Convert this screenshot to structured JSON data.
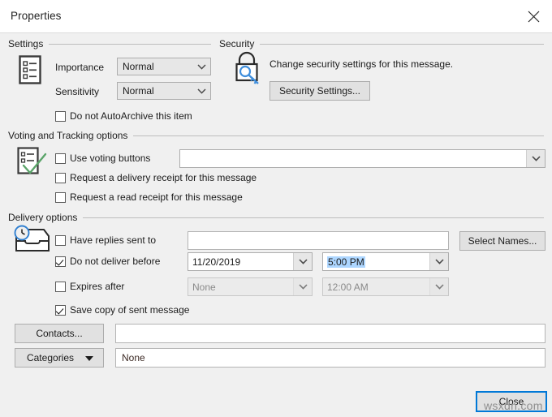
{
  "window": {
    "title": "Properties",
    "close_icon": "close-x-icon"
  },
  "groups": {
    "settings": "Settings",
    "security": "Security",
    "voting": "Voting and Tracking options",
    "delivery": "Delivery options"
  },
  "settings": {
    "icon": "settings-list-icon",
    "importance_label": "Importance",
    "importance_value": "Normal",
    "sensitivity_label": "Sensitivity",
    "sensitivity_value": "Normal",
    "autoarchive_label": "Do not AutoArchive this item",
    "autoarchive_checked": false
  },
  "security": {
    "icon": "lock-key-icon",
    "description": "Change security settings for this message.",
    "settings_button": "Security Settings..."
  },
  "voting": {
    "icon": "voting-checklist-icon",
    "use_voting_label": "Use voting buttons",
    "use_voting_checked": false,
    "voting_value": "",
    "delivery_receipt_label": "Request a delivery receipt for this message",
    "delivery_receipt_checked": false,
    "read_receipt_label": "Request a read receipt for this message",
    "read_receipt_checked": false
  },
  "delivery": {
    "icon": "inbox-clock-icon",
    "have_replies_label": "Have replies sent to",
    "have_replies_checked": false,
    "have_replies_value": "",
    "select_names_button": "Select Names...",
    "not_deliver_label": "Do not deliver before",
    "not_deliver_checked": true,
    "not_deliver_date": "11/20/2019",
    "not_deliver_time": "5:00 PM",
    "expires_label": "Expires after",
    "expires_checked": false,
    "expires_date": "None",
    "expires_time": "12:00 AM",
    "save_copy_label": "Save copy of sent message",
    "save_copy_checked": true,
    "contacts_button": "Contacts...",
    "contacts_value": "",
    "categories_button_prefix": "Cate",
    "categories_button_accel": "g",
    "categories_button_suffix": "ories",
    "categories_value": "None"
  },
  "footer": {
    "close_button": "Close"
  },
  "overlay": {
    "watermark": "wsxdn.com"
  },
  "colors": {
    "accent": "#0078d7",
    "selection": "#add6ff",
    "dialog_bg": "#f0f0f0",
    "titlebar_bg": "#ffffff",
    "rule": "#bdbdbd"
  }
}
